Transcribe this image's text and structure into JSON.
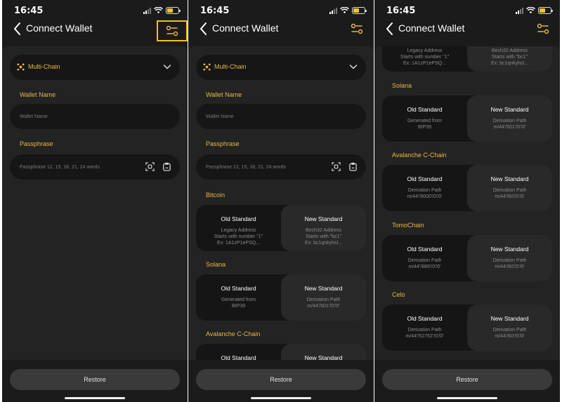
{
  "screens": [
    {
      "time": "16:45",
      "title": "Connect Wallet"
    },
    {
      "time": "16:45",
      "title": "Connect Wallet"
    },
    {
      "time": "16:45",
      "title": "Connect Wallet"
    }
  ],
  "form": {
    "chain_select": "Multi-Chain",
    "wallet_name_label": "Wallet Name",
    "wallet_name_placeholder": "Wallet Name",
    "passphrase_label": "Passphrase",
    "passphrase_placeholder": "Passphrase 12, 15, 18, 21, 24 words"
  },
  "chains": {
    "bitcoin": {
      "label": "Bitcoin",
      "old_title": "Old Standard",
      "old_desc": "Legacy Address\nStarts with number \"1\"\nEx: 1A1zP1ePSQ...",
      "new_title": "New Standard",
      "new_desc": "Bech32 Address\nStarts with \"bc1\"\nEx: bc1qnkyhsl..."
    },
    "solana": {
      "label": "Solana",
      "old_title": "Old Standard",
      "old_desc": "Generated from\nBIP39",
      "new_title": "New Standard",
      "new_desc": "Derivation Path\nm/44'/501'/0'/0'"
    },
    "avalanche": {
      "label": "Avalanche C-Chain",
      "old_title": "Old Standard",
      "old_desc": "Derivation Path\nm/44'/9000'/0'/0'",
      "new_title": "New Standard",
      "new_desc": "Derivation Path\nm/44'/60'/0'/0'"
    },
    "tomochain": {
      "label": "TomoChain",
      "old_title": "Old Standard",
      "old_desc": "Derivation Path\nm/44'/889'/0'/0'",
      "new_title": "New Standard",
      "new_desc": "Derivation Path\nm/44'/60'/0'/0'"
    },
    "celo": {
      "label": "Celo",
      "old_title": "Old Standard",
      "old_desc": "Derivation Path\nm/44'/52752'/0'/0'",
      "new_title": "New Standard",
      "new_desc": "Derivation Path\nm/44'/60'/0'/0'"
    }
  },
  "restore_label": "Restore",
  "icons": {
    "back": "chevron-left-icon",
    "filter": "filter-settings-icon",
    "chain": "multi-chain-icon",
    "dropdown": "chevron-down-icon",
    "scan": "scan-qr-icon",
    "paste": "paste-clipboard-icon"
  },
  "colors": {
    "accent": "#e8b845",
    "highlight_box": "#f0c419",
    "background": "#1b1b1b",
    "panel": "#232323",
    "field": "#161616",
    "button": "#3a3a3a"
  }
}
